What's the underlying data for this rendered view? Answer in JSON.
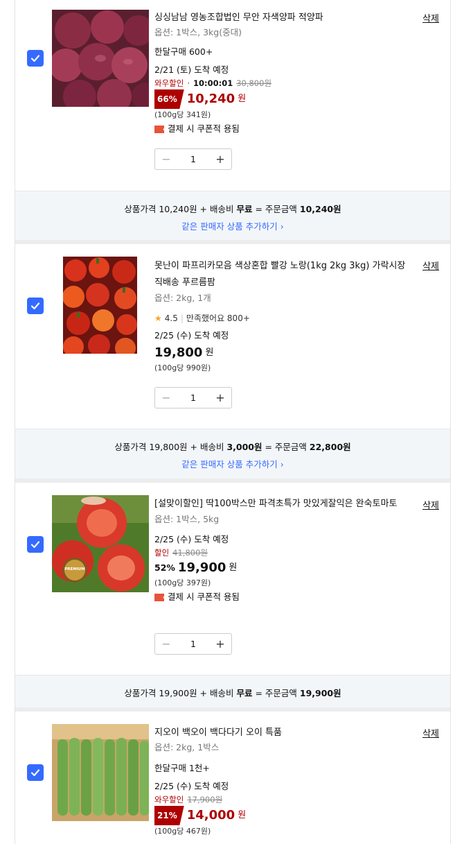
{
  "delete_label": "삭제",
  "items": [
    {
      "title": "싱싱남남 영농조합법인 무안 자색양파 적양파",
      "option": "옵션: 1박스, 3kg(중대)",
      "monthly": "한달구매 600+",
      "arrival": "2/21 (토) 도착 예정",
      "discount_label": "와우할인",
      "timer": "10:00:01",
      "original_price": "30,800원",
      "discount_pct": "66%",
      "price": "10,240",
      "won": "원",
      "unit_price": "(100g당 341원)",
      "coupon": "결제 시 쿠폰적 용됨",
      "qty": "1",
      "summary": {
        "prefix": "상품가격 10,240원 + 배송비 ",
        "shipping": "무료",
        "mid": " = 주문금액 ",
        "total": "10,240원"
      },
      "add_link": "같은 판매자 상품 추가하기 ›"
    },
    {
      "title": "못난이 파프리카모음 색상혼합 빨강 노랑(1kg 2kg 3kg) 가락시장 직배송 푸르름팜",
      "option": "옵션: 2kg, 1개",
      "rating": "4.5",
      "review": "만족했어요 800+",
      "arrival": "2/25 (수) 도착 예정",
      "price": "19,800",
      "won": "원",
      "unit_price": "(100g당 990원)",
      "qty": "1",
      "summary": {
        "prefix": "상품가격 19,800원 + 배송비 ",
        "shipping": "3,000원",
        "mid": " = 주문금액 ",
        "total": "22,800원"
      },
      "add_link": "같은 판매자 상품 추가하기 ›"
    },
    {
      "title": "[설맞이할인] 딱100박스만 파격초특가 맛있게잘익은 완숙토마토",
      "option": "옵션: 1박스, 5kg",
      "arrival": "2/25 (수) 도착 예정",
      "discount_label": "할인",
      "original_price": "41,800원",
      "discount_pct": "52%",
      "price": "19,900",
      "won": "원",
      "unit_price": "(100g당 397원)",
      "coupon": "결제 시 쿠폰적 용됨",
      "qty": "1",
      "badge": "PREMIUM",
      "summary": {
        "prefix": "상품가격 19,900원 + 배송비 ",
        "shipping": "무료",
        "mid": " = 주문금액 ",
        "total": "19,900원"
      }
    },
    {
      "title": "지오이 백오이 백다다기 오이 특품",
      "option": "옵션: 2kg, 1박스",
      "monthly": "한달구매 1천+",
      "arrival": "2/25 (수) 도착 예정",
      "discount_label": "와우할인",
      "original_price": "17,900원",
      "discount_pct": "21%",
      "price": "14,000",
      "won": "원",
      "unit_price": "(100g당 467원)"
    }
  ],
  "colors": {
    "accent": "#346aff",
    "sale_red": "#ae0000",
    "summary_bg": "#f3f6f9"
  }
}
